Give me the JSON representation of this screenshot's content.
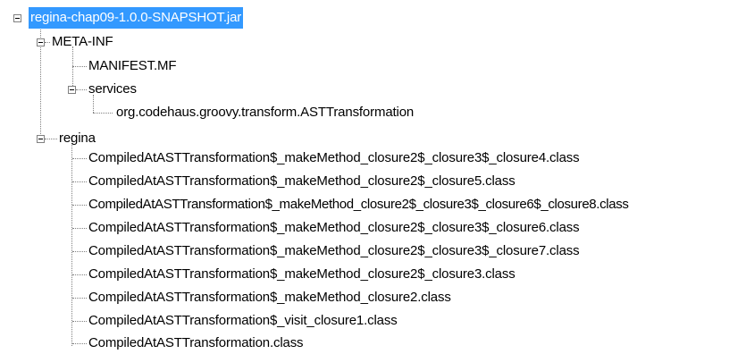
{
  "tree": {
    "root": {
      "label": "regina-chap09-1.0.0-SNAPSHOT.jar",
      "expanded": true,
      "selected": true
    },
    "meta_inf": {
      "label": "META-INF",
      "expanded": true,
      "manifest": "MANIFEST.MF",
      "services": {
        "label": "services",
        "expanded": true,
        "items": [
          "org.codehaus.groovy.transform.ASTTransformation"
        ]
      }
    },
    "regina": {
      "label": "regina",
      "expanded": true,
      "items": [
        "CompiledAtASTTransformation$_makeMethod_closure2$_closure3$_closure4.class",
        "CompiledAtASTTransformation$_makeMethod_closure2$_closure5.class",
        "CompiledAtASTTransformation$_makeMethod_closure2$_closure3$_closure6$_closure8.class",
        "CompiledAtASTTransformation$_makeMethod_closure2$_closure3$_closure6.class",
        "CompiledAtASTTransformation$_makeMethod_closure2$_closure3$_closure7.class",
        "CompiledAtASTTransformation$_makeMethod_closure2$_closure3.class",
        "CompiledAtASTTransformation$_makeMethod_closure2.class",
        "CompiledAtASTTransformation$_visit_closure1.class",
        "CompiledAtASTTransformation.class"
      ]
    }
  },
  "colors": {
    "selection": "#3399ff",
    "connector": "#808080"
  }
}
